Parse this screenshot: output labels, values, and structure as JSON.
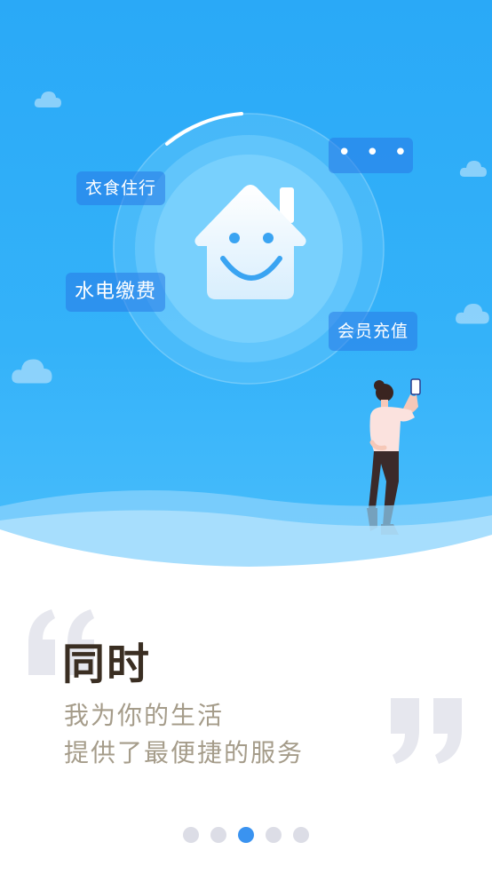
{
  "hero": {
    "tags": {
      "food": "衣食住行",
      "bills": "水电缴费",
      "member": "会员充值",
      "more": "• • •"
    },
    "icons": [
      "cloud-icon",
      "house-smile-icon",
      "person-with-phone-illustration"
    ]
  },
  "content": {
    "headline": "同时",
    "line1": "我为你的生活",
    "line2": "提供了最便捷的服务"
  },
  "pager": {
    "total": 5,
    "active_index": 2
  },
  "colors": {
    "sky": "#34b2f9",
    "headline": "#3a2e22",
    "subtext": "#a59c8a",
    "dot_active": "#3a93f0",
    "dot_inactive": "#dcdde6"
  }
}
